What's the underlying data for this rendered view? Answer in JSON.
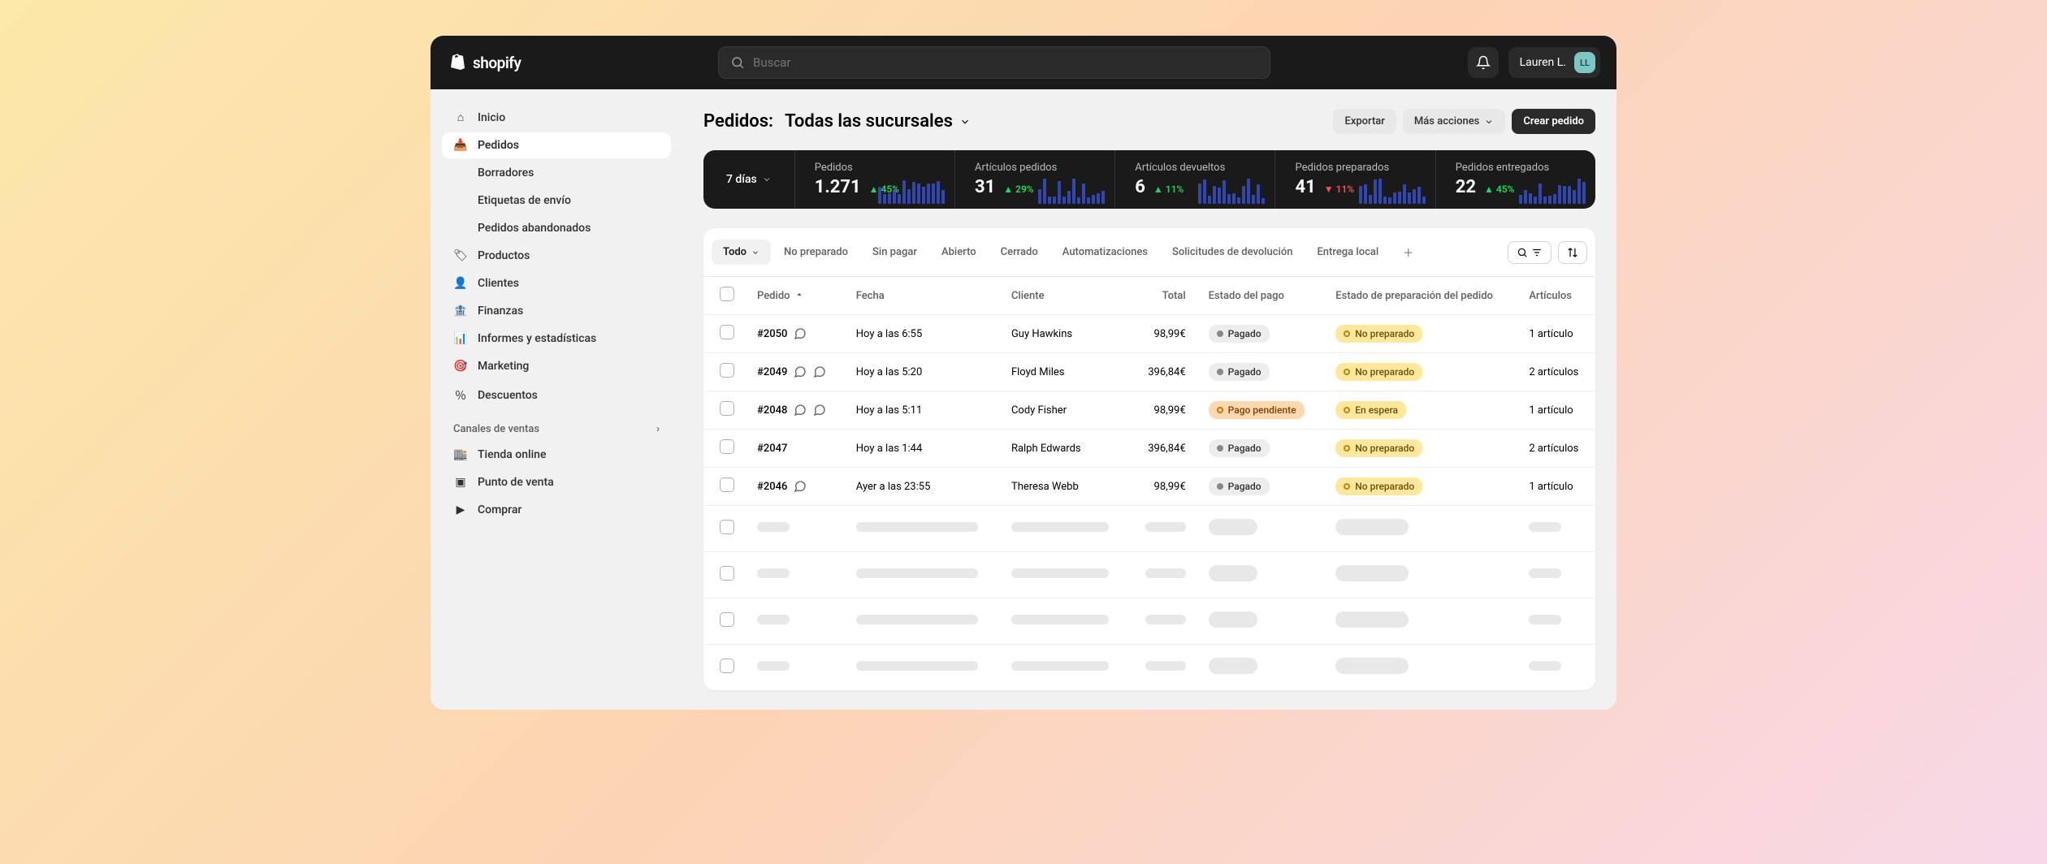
{
  "brand": "shopify",
  "search": {
    "placeholder": "Buscar"
  },
  "user": {
    "name": "Lauren L.",
    "initials": "LL"
  },
  "sidebar": {
    "items": {
      "home": "Inicio",
      "orders": "Pedidos",
      "drafts": "Borradores",
      "shipping_labels": "Etiquetas de envío",
      "abandoned": "Pedidos abandonados",
      "products": "Productos",
      "customers": "Clientes",
      "finance": "Finanzas",
      "analytics": "Informes y estadísticas",
      "marketing": "Marketing",
      "discounts": "Descuentos"
    },
    "channels_label": "Canales de ventas",
    "channels": {
      "online": "Tienda online",
      "pos": "Punto de venta",
      "buy": "Comprar"
    }
  },
  "page": {
    "title_prefix": "Pedidos:",
    "title_filter": "Todas las sucursales",
    "export": "Exportar",
    "more_actions": "Más acciones",
    "create": "Crear pedido"
  },
  "stats": {
    "period": "7 días",
    "items": [
      {
        "label": "Pedidos",
        "value": "1.271",
        "delta": "45%",
        "dir": "up"
      },
      {
        "label": "Artículos pedidos",
        "value": "31",
        "delta": "29%",
        "dir": "up"
      },
      {
        "label": "Artículos devueltos",
        "value": "6",
        "delta": "11%",
        "dir": "up"
      },
      {
        "label": "Pedidos preparados",
        "value": "41",
        "delta": "11%",
        "dir": "down"
      },
      {
        "label": "Pedidos entregados",
        "value": "22",
        "delta": "45%",
        "dir": "up"
      }
    ]
  },
  "tabs": [
    "Todo",
    "No preparado",
    "Sin pagar",
    "Abierto",
    "Cerrado",
    "Automatizaciones",
    "Solicitudes de devolución",
    "Entrega local"
  ],
  "columns": {
    "order": "Pedido",
    "date": "Fecha",
    "customer": "Cliente",
    "total": "Total",
    "payment": "Estado del pago",
    "fulfillment": "Estado de preparación del pedido",
    "items": "Artículos"
  },
  "badges": {
    "paid": "Pagado",
    "pending": "Pago pendiente",
    "unfulfilled": "No preparado",
    "hold": "En espera"
  },
  "orders": [
    {
      "id": "#2050",
      "notes": 1,
      "date": "Hoy a las 6:55",
      "customer": "Guy Hawkins",
      "total": "98,99€",
      "payment": "paid",
      "fulfillment": "unfulfilled",
      "items": "1 artículo"
    },
    {
      "id": "#2049",
      "notes": 2,
      "date": "Hoy a las 5:20",
      "customer": "Floyd Miles",
      "total": "396,84€",
      "payment": "paid",
      "fulfillment": "unfulfilled",
      "items": "2 artículos"
    },
    {
      "id": "#2048",
      "notes": 2,
      "date": "Hoy a las 5:11",
      "customer": "Cody Fisher",
      "total": "98,99€",
      "payment": "pending",
      "fulfillment": "hold",
      "items": "1 artículo"
    },
    {
      "id": "#2047",
      "notes": 0,
      "date": "Hoy a las 1:44",
      "customer": "Ralph Edwards",
      "total": "396,84€",
      "payment": "paid",
      "fulfillment": "unfulfilled",
      "items": "2 artículos"
    },
    {
      "id": "#2046",
      "notes": 1,
      "date": "Ayer a las 23:55",
      "customer": "Theresa Webb",
      "total": "98,99€",
      "payment": "paid",
      "fulfillment": "unfulfilled",
      "items": "1 artículo"
    }
  ],
  "skeleton_rows": 4
}
